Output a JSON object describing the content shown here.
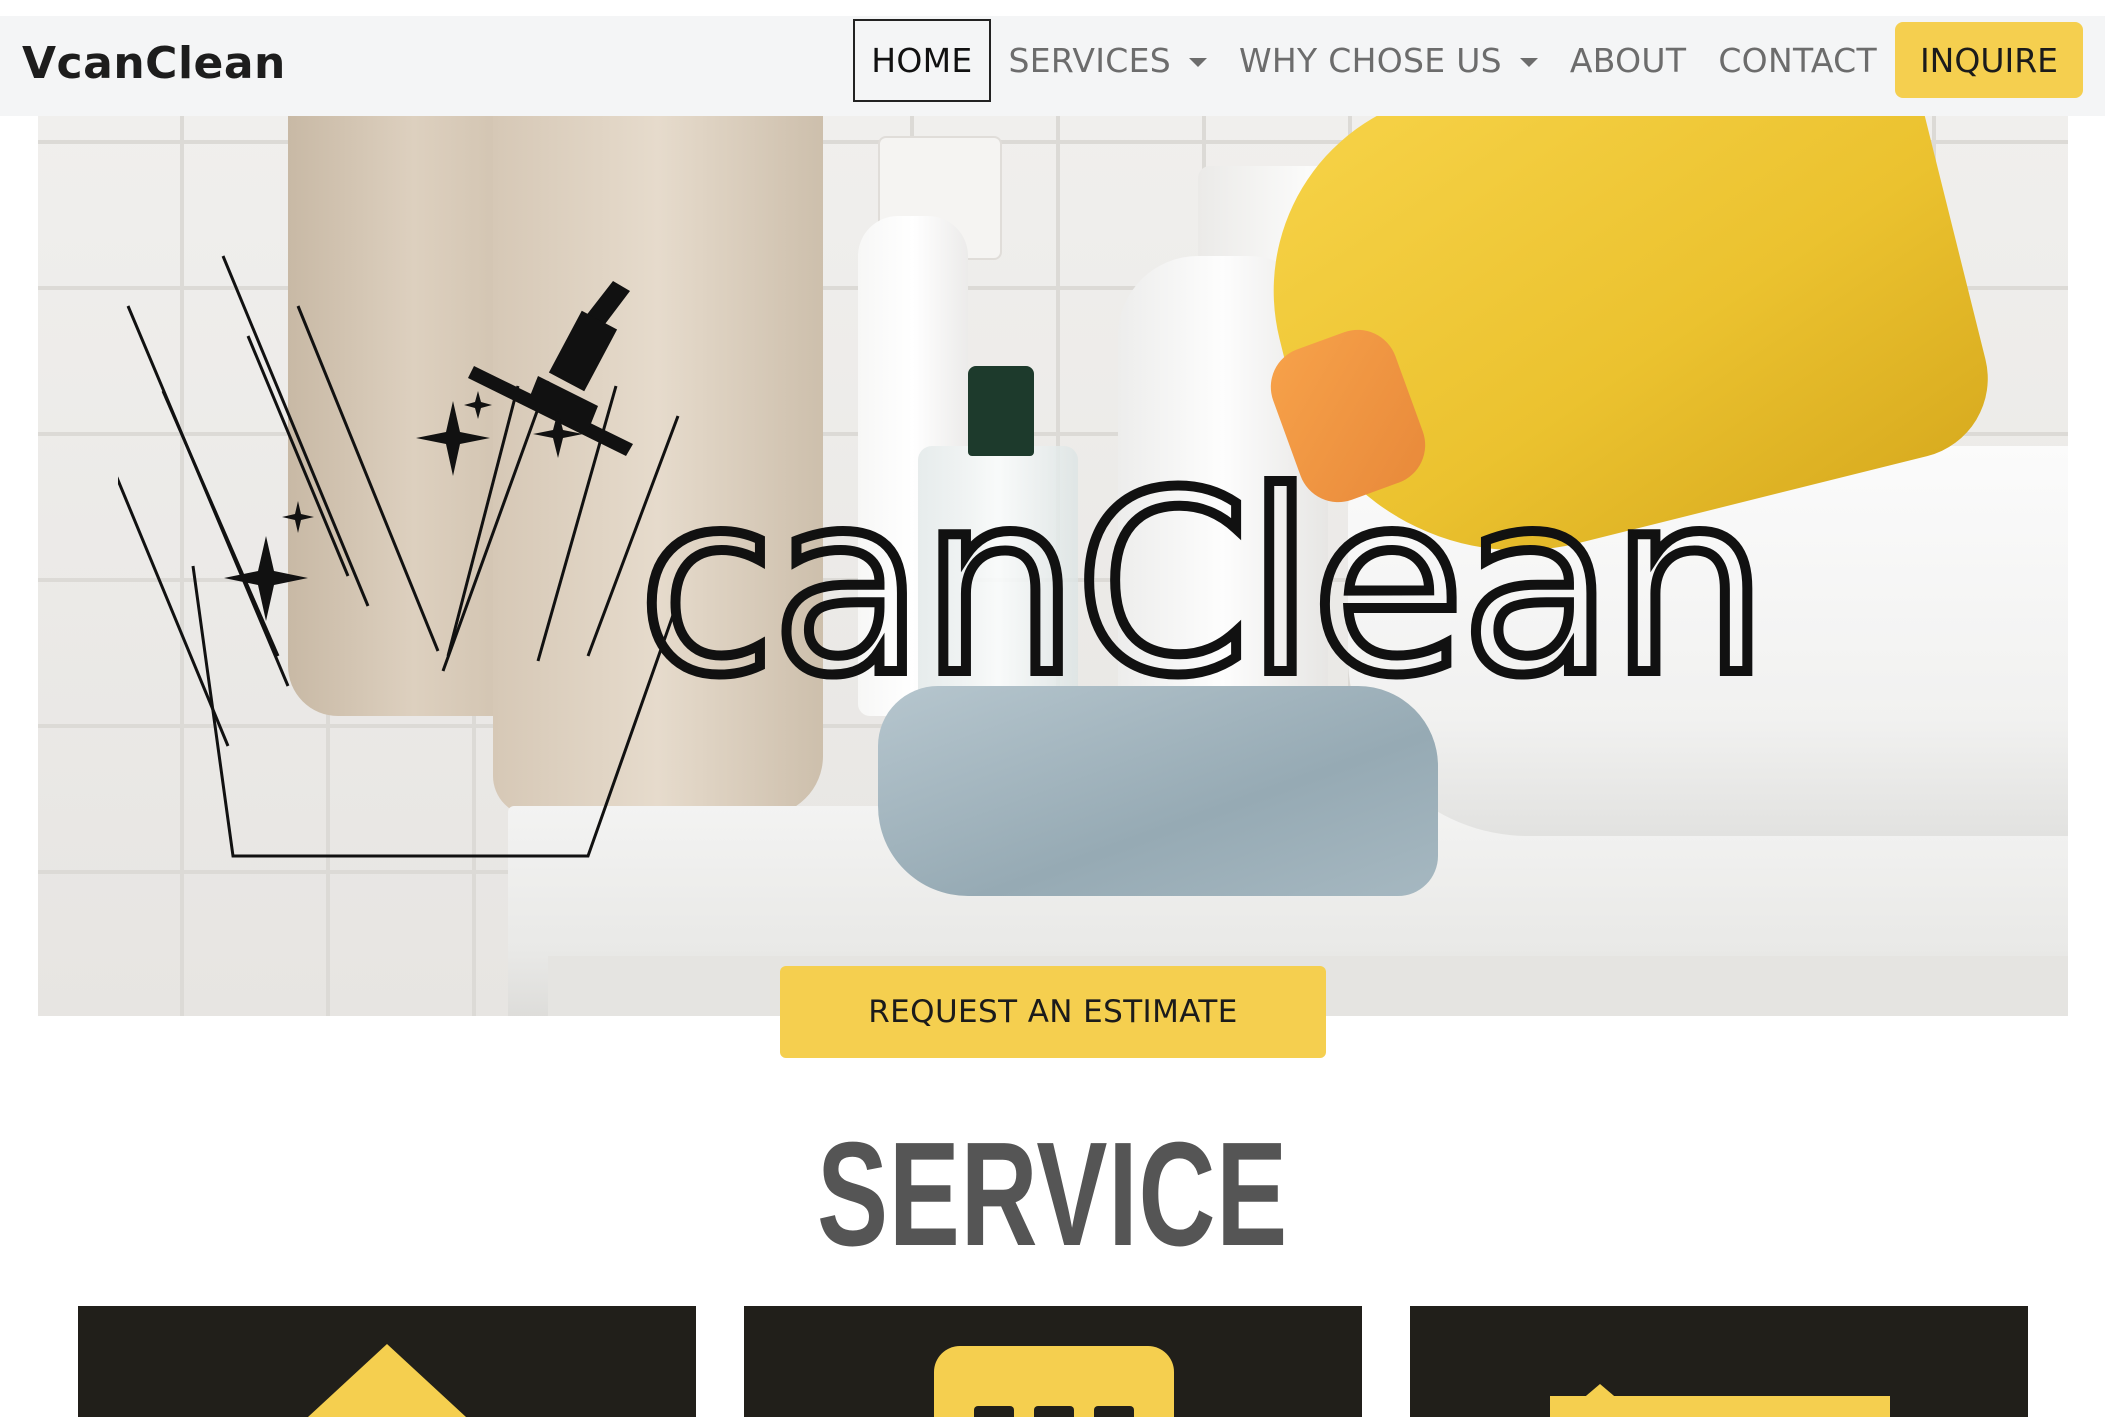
{
  "brand": {
    "name": "VcanClean"
  },
  "nav": {
    "items": [
      {
        "label": "HOME",
        "active": true,
        "dropdown": false
      },
      {
        "label": "SERVICES",
        "active": false,
        "dropdown": true
      },
      {
        "label": "WHY CHOSE US",
        "active": false,
        "dropdown": true
      },
      {
        "label": "ABOUT",
        "active": false,
        "dropdown": false
      },
      {
        "label": "CONTACT",
        "active": false,
        "dropdown": false
      }
    ],
    "cta_label": "INQUIRE"
  },
  "hero": {
    "logo_text": "canClean",
    "estimate_label": "REQUEST AN ESTIMATE"
  },
  "service": {
    "title": "SERVICE",
    "cards": [
      {
        "icon": "house-icon"
      },
      {
        "icon": "calendar-icon"
      },
      {
        "icon": "building-icon"
      }
    ]
  },
  "colors": {
    "accent": "#f5cf4f",
    "navbar_bg": "#f4f5f6",
    "card_bg": "#211f1a",
    "title": "#555555"
  }
}
